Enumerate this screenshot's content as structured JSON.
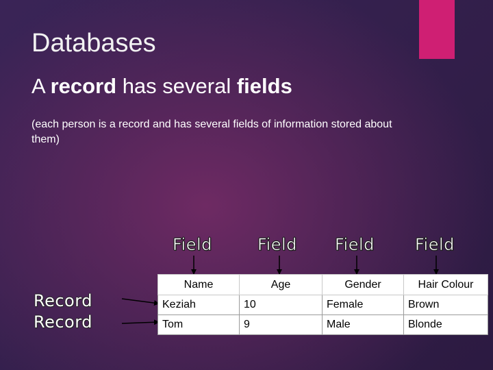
{
  "slide": {
    "title": "Databases",
    "subtitle_pre": "A ",
    "subtitle_record": "record",
    "subtitle_mid": " has several ",
    "subtitle_fields": "fields",
    "note": "(each person is a record and has several fields of information stored about them)"
  },
  "labels": {
    "fields": [
      "Field",
      "Field",
      "Field",
      "Field"
    ],
    "records": [
      "Record",
      "Record"
    ]
  },
  "table": {
    "headers": [
      "Name",
      "Age",
      "Gender",
      "Hair Colour"
    ],
    "rows": [
      [
        "Keziah",
        "10",
        "Female",
        "Brown"
      ],
      [
        "Tom",
        "9",
        "Male",
        "Blonde"
      ]
    ]
  },
  "colors": {
    "accent": "#cf1f73",
    "background": "#3a2457"
  }
}
